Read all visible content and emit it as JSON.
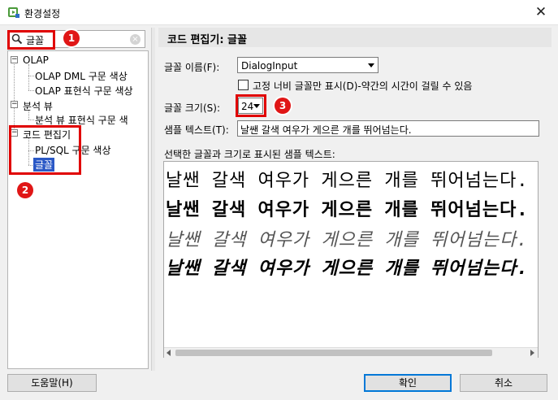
{
  "window": {
    "title": "환경설정",
    "close_glyph": "✕"
  },
  "search": {
    "value": "글꼴",
    "clear_glyph": "×"
  },
  "tree": {
    "items": [
      {
        "label": "OLAP",
        "expander": "−"
      },
      {
        "label": "OLAP DML 구문 색상"
      },
      {
        "label": "OLAP 표현식 구문 색상"
      },
      {
        "label": "분석 뷰",
        "expander": "−"
      },
      {
        "label": "분석 뷰 표현식 구문 색"
      },
      {
        "label": "코드 편집기",
        "expander": "−"
      },
      {
        "label": "PL/SQL 구문 색상"
      },
      {
        "label": "글꼴",
        "selected": true
      }
    ]
  },
  "panel": {
    "title": "코드 편집기: 글꼴",
    "font_name_label": "글꼴 이름(F):",
    "font_name_value": "DialogInput",
    "fixed_width_label": "고정 너비 글꼴만 표시(D)-약간의 시간이 걸릴 수 있음",
    "font_size_label": "글꼴 크기(S):",
    "font_size_value": "24",
    "sample_text_label": "샘플 텍스트(T):",
    "sample_text_value": "날쌘 갈색 여우가 게으른 개를 뛰어넘는다.",
    "preview_label": "선택한 글꼴과 크기로 표시된 샘플 텍스트:",
    "preview_lines": [
      "날쌘 갈색 여우가 게으른 개를 뛰어넘는다.",
      "날쌘 갈색 여우가 게으른 개를 뛰어넘는다.",
      "날쌘 갈색 여우가 게으른 개를 뛰어넘는다.",
      "날쌘 갈색 여우가 게으른 개를 뛰어넘는다."
    ]
  },
  "buttons": {
    "help": "도움말(H)",
    "ok": "확인",
    "cancel": "취소"
  },
  "annotations": {
    "badges": [
      "1",
      "2",
      "3"
    ],
    "color": "#e00000"
  }
}
